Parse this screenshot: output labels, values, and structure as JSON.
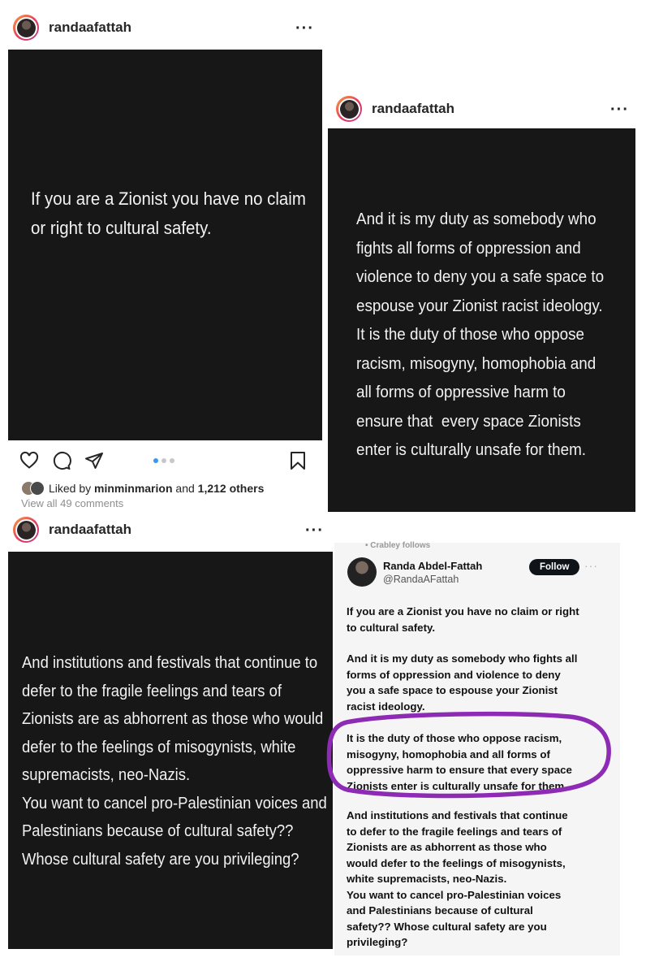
{
  "post1": {
    "username": "randaafattah",
    "more_icon": "more-horizontal-icon",
    "text_lines": [
      "If you are a Zionist you have no claim",
      "or right to cultural safety."
    ],
    "liked_prefix": "Liked by ",
    "liked_user": "minminmarion",
    "liked_middle": " and ",
    "liked_count": "1,212 others",
    "view_comments": "View all 49 comments"
  },
  "post2": {
    "username": "randaafattah",
    "text_lines": [
      "And it is my duty as somebody who",
      "fights all forms of oppression and",
      "violence to deny you a safe space to",
      "espouse your Zionist racist ideology.",
      "It is the duty of those who oppose",
      "racism, misogyny, homophobia and",
      "all forms of oppressive harm to",
      "ensure that  every space Zionists",
      "enter is culturally unsafe for them."
    ]
  },
  "post3": {
    "username": "randaafattah",
    "text_lines": [
      "And institutions and festivals that continue to",
      "defer to the fragile feelings and tears of",
      "Zionists are as abhorrent as those who would",
      "defer to the feelings of misogynists, white",
      "supremacists, neo-Nazis.",
      "You want to cancel pro-Palestinian voices and",
      "Palestinians because of cultural safety??",
      "Whose cultural safety are you privileging?"
    ]
  },
  "tweet": {
    "context_line": "• Crabley follows",
    "name": "Randa Abdel-Fattah",
    "handle": "@RandaAFattah",
    "follow_label": "Follow",
    "highlight_color": "#8e2bb5",
    "para1": [
      "If you are a Zionist you have no claim or right",
      "to cultural safety."
    ],
    "para2": [
      "And it is my duty as somebody who fights all",
      "forms of oppression and violence to deny",
      "you a safe space to espouse your Zionist",
      "racist ideology."
    ],
    "para3": [
      "It is the duty of those who oppose racism,",
      "misogyny, homophobia and all forms of",
      "oppressive harm to ensure that every space",
      "Zionists enter is culturally unsafe for them."
    ],
    "para4": [
      "And institutions and festivals that continue",
      "to defer to the fragile feelings and tears of",
      "Zionists are as abhorrent as those who",
      "would defer to the feelings of misogynists,",
      "white supremacists, neo-Nazis.",
      "You want to cancel pro-Palestinian voices",
      "and Palestinians because of cultural",
      "safety?? Whose cultural safety are you",
      "privileging?"
    ]
  }
}
